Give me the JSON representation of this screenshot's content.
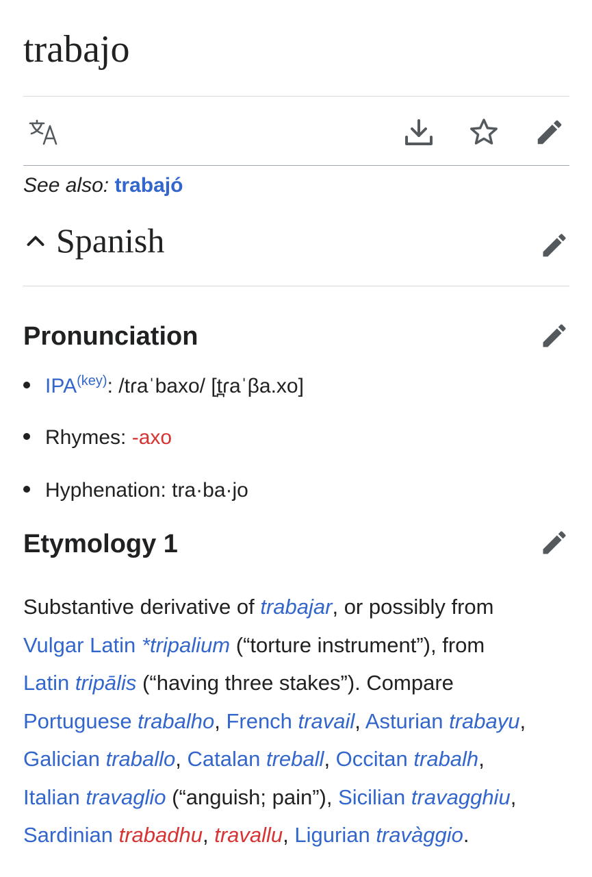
{
  "page": {
    "title": "trabajo"
  },
  "toolbar": {
    "icons": [
      "translate-icon",
      "download-icon",
      "star-icon",
      "edit-icon"
    ]
  },
  "see_also": {
    "label": "See also:",
    "link": "trabajó"
  },
  "language": {
    "name": "Spanish"
  },
  "pronunciation": {
    "heading": "Pronunciation",
    "ipa_label": "IPA",
    "ipa_key": "(key)",
    "ipa_value": ": /tɾaˈbaxo/ [t̪ɾaˈβa.xo]",
    "rhymes_label": "Rhymes: ",
    "rhymes_value": "-axo",
    "hyphenation_label": "Hyphenation: ",
    "hyphenation_value": "tra·ba·jo"
  },
  "etymology": {
    "heading": "Etymology 1",
    "lines": [
      [
        {
          "t": "Substantive derivative of ",
          "s": "plain"
        },
        {
          "t": "trabajar",
          "s": "link-i"
        },
        {
          "t": ", or possibly from",
          "s": "plain"
        }
      ],
      [
        {
          "t": "Vulgar Latin ",
          "s": "link"
        },
        {
          "t": "*tripalium",
          "s": "link-i"
        },
        {
          "t": " (“torture instrument”), from",
          "s": "plain"
        }
      ],
      [
        {
          "t": "Latin ",
          "s": "link"
        },
        {
          "t": "tripālis",
          "s": "link-i"
        },
        {
          "t": " (“having three stakes”). Compare",
          "s": "plain"
        }
      ],
      [
        {
          "t": "Portuguese ",
          "s": "link"
        },
        {
          "t": "trabalho",
          "s": "link-i"
        },
        {
          "t": ", ",
          "s": "plain"
        },
        {
          "t": "French ",
          "s": "link"
        },
        {
          "t": "travail",
          "s": "link-i"
        },
        {
          "t": ", ",
          "s": "plain"
        },
        {
          "t": "Asturian ",
          "s": "link"
        },
        {
          "t": "trabayu",
          "s": "link-i"
        },
        {
          "t": ",",
          "s": "plain"
        }
      ],
      [
        {
          "t": "Galician ",
          "s": "link"
        },
        {
          "t": "traballo",
          "s": "link-i"
        },
        {
          "t": ", ",
          "s": "plain"
        },
        {
          "t": "Catalan ",
          "s": "link"
        },
        {
          "t": "treball",
          "s": "link-i"
        },
        {
          "t": ", ",
          "s": "plain"
        },
        {
          "t": "Occitan ",
          "s": "link"
        },
        {
          "t": "trabalh",
          "s": "link-i"
        },
        {
          "t": ",",
          "s": "plain"
        }
      ],
      [
        {
          "t": "Italian ",
          "s": "link"
        },
        {
          "t": "travaglio",
          "s": "link-i"
        },
        {
          "t": " (“anguish; pain”), ",
          "s": "plain"
        },
        {
          "t": "Sicilian ",
          "s": "link"
        },
        {
          "t": "travagghiu",
          "s": "link-i"
        },
        {
          "t": ",",
          "s": "plain"
        }
      ],
      [
        {
          "t": "Sardinian ",
          "s": "link"
        },
        {
          "t": "trabadhu",
          "s": "red-i"
        },
        {
          "t": ", ",
          "s": "plain"
        },
        {
          "t": "travallu",
          "s": "red-i"
        },
        {
          "t": ", ",
          "s": "plain"
        },
        {
          "t": "Ligurian ",
          "s": "link"
        },
        {
          "t": "travàggio",
          "s": "link-i"
        },
        {
          "t": ".",
          "s": "plain"
        }
      ]
    ]
  },
  "colors": {
    "link": "#3366cc",
    "redlink": "#d73333",
    "text": "#202122",
    "icon": "#54595d"
  }
}
